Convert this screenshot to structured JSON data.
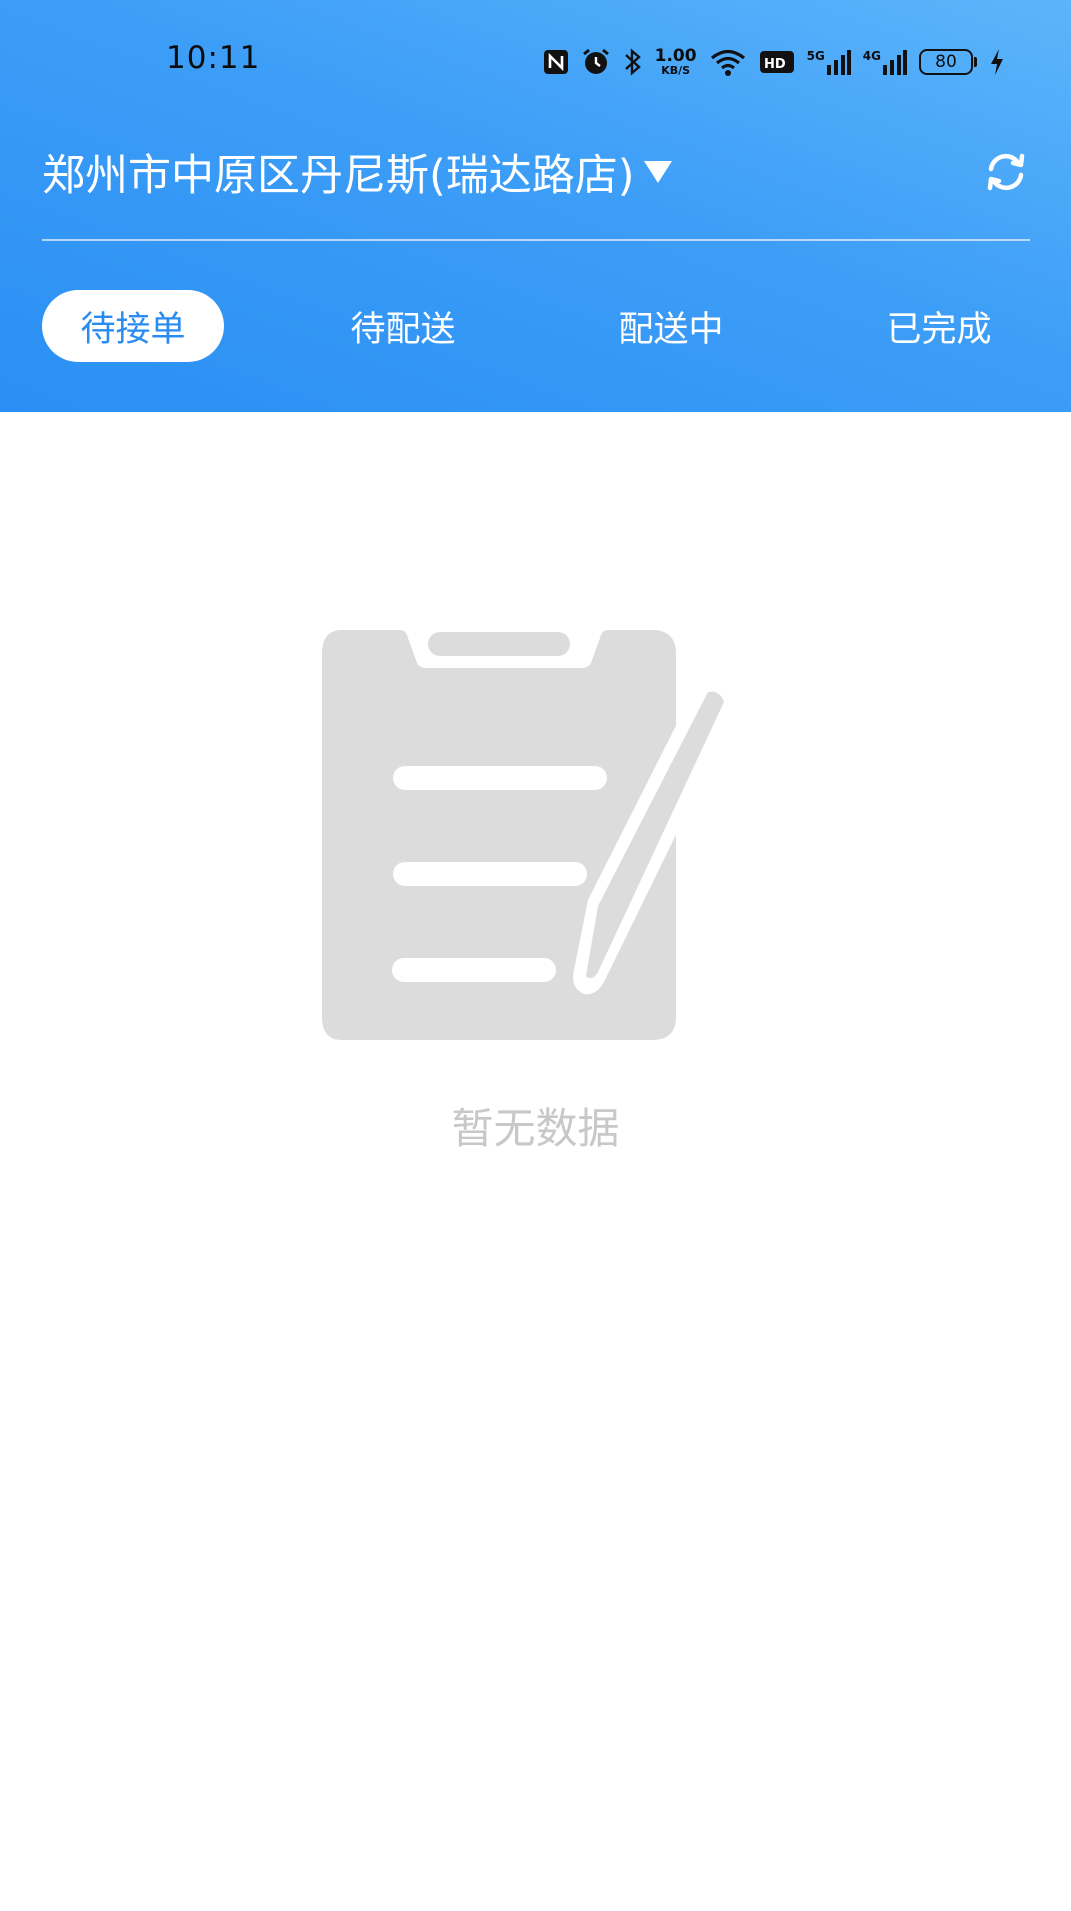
{
  "status_bar": {
    "time": "10:11",
    "net_speed_value": "1.00",
    "net_speed_unit": "KB/S",
    "hd_label": "HD",
    "sim1_label": "5G",
    "sim2_label": "4G",
    "battery_level": "80",
    "icons": [
      "nfc-icon",
      "alarm-icon",
      "bluetooth-icon",
      "wifi-icon",
      "hd-voice-icon",
      "signal-5g-icon",
      "signal-4g-icon",
      "battery-icon",
      "charging-icon"
    ]
  },
  "header": {
    "store_name": "郑州市中原区丹尼斯(瑞达路店)",
    "dropdown_icon": "triangle-down-icon",
    "refresh_icon": "refresh-icon",
    "background_colors": [
      "#5cb5fb",
      "#2a8ff4"
    ]
  },
  "tabs": [
    {
      "label": "待接单",
      "active": true
    },
    {
      "label": "待配送",
      "active": false
    },
    {
      "label": "配送中",
      "active": false
    },
    {
      "label": "已完成",
      "active": false
    }
  ],
  "accent_color": "#2a8bf0",
  "empty_state": {
    "icon": "clipboard-pen-icon",
    "text": "暂无数据"
  }
}
